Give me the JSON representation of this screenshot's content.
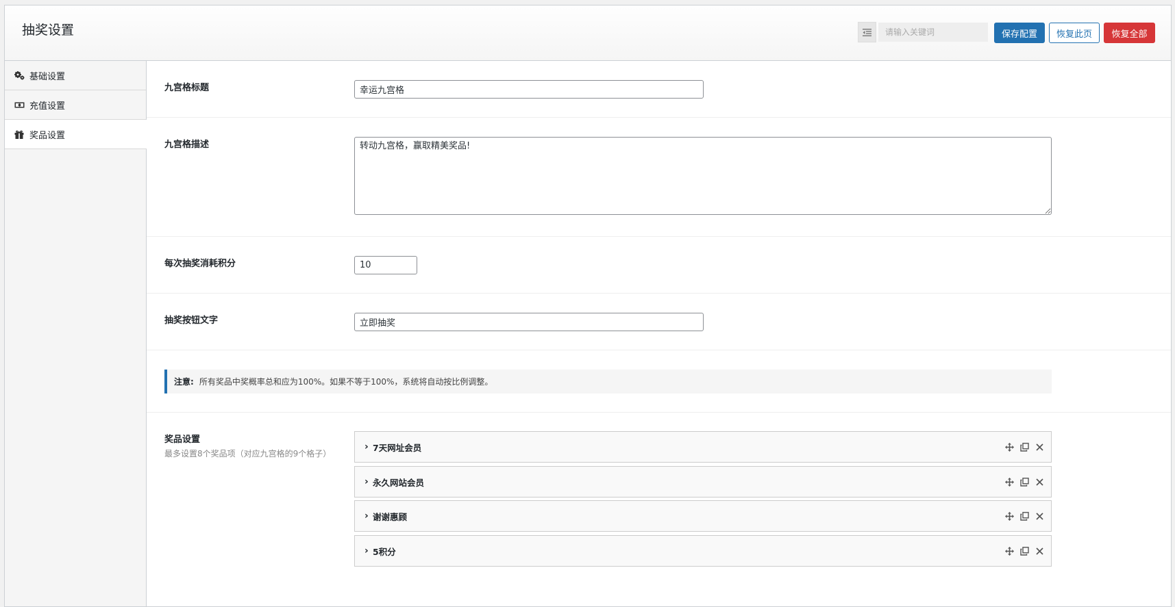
{
  "header": {
    "title": "抽奖设置",
    "search_placeholder": "请输入关键词",
    "save_label": "保存配置",
    "restore_page_label": "恢复此页",
    "restore_all_label": "恢复全部"
  },
  "sidebar": {
    "items": [
      {
        "label": "基础设置",
        "icon": "cogs-icon"
      },
      {
        "label": "充值设置",
        "icon": "money-icon"
      },
      {
        "label": "奖品设置",
        "icon": "gift-icon",
        "active": true
      }
    ]
  },
  "fields": {
    "grid_title": {
      "label": "九宫格标题",
      "value": "幸运九宫格"
    },
    "grid_desc": {
      "label": "九宫格描述",
      "value": "转动九宫格，赢取精美奖品!"
    },
    "cost_points": {
      "label": "每次抽奖消耗积分",
      "value": "10"
    },
    "button_text": {
      "label": "抽奖按钮文字",
      "value": "立即抽奖"
    }
  },
  "notice": {
    "prefix": "注意:",
    "text": "所有奖品中奖概率总和应为100%。如果不等于100%，系统将自动按比例调整。"
  },
  "prizes": {
    "label": "奖品设置",
    "sublabel": "最多设置8个奖品项（对应九宫格的9个格子）",
    "items": [
      {
        "title": "7天网址会员"
      },
      {
        "title": "永久网站会员"
      },
      {
        "title": "谢谢惠顾"
      },
      {
        "title": "5积分"
      }
    ]
  },
  "colors": {
    "primary": "#2271b1",
    "danger": "#d63638"
  }
}
